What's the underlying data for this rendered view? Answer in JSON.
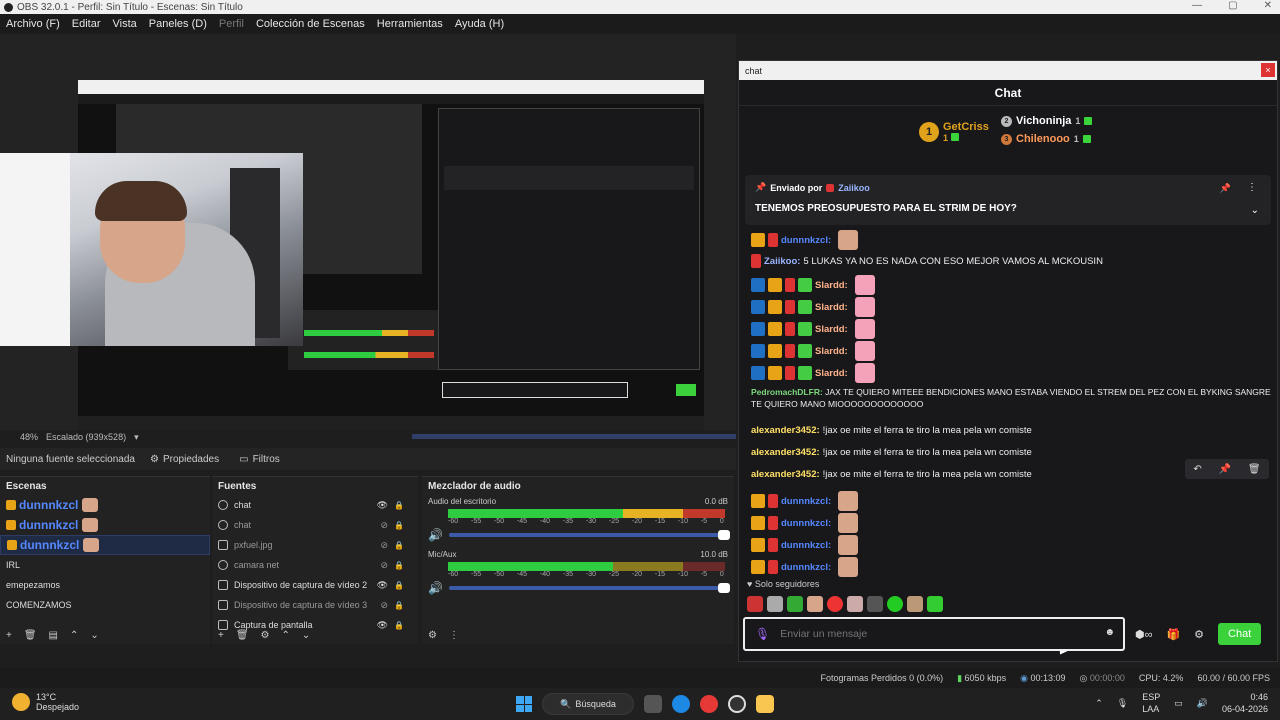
{
  "window": {
    "title": "OBS 32.0.1 - Perfil: Sin Título - Escenas: Sin Título",
    "controls": [
      "—",
      "▢",
      "✕"
    ]
  },
  "menu": [
    "Archivo (F)",
    "Editar",
    "Vista",
    "Paneles (D)",
    "Perfil",
    "Colección de Escenas",
    "Herramientas",
    "Ayuda (H)"
  ],
  "zoom": {
    "level": "48%",
    "scaling": "Escalado (939x528)"
  },
  "props": {
    "none_selected": "Ninguna fuente seleccionada",
    "properties": "Propiedades",
    "filters": "Filtros"
  },
  "scenes": {
    "title": "Escenas",
    "items": [
      "dunnnkzcl",
      "dunnnkzcl",
      "dunnnkzcl",
      "IRL",
      "emepezamos",
      "COMENZAMOS"
    ]
  },
  "sources": {
    "title": "Fuentes",
    "items": [
      {
        "label": "chat",
        "icon": "globe-icon"
      },
      {
        "label": "chat",
        "icon": "globe-icon"
      },
      {
        "label": "pxfuel.jpg",
        "icon": "image-icon"
      },
      {
        "label": "camara net",
        "icon": "globe-icon"
      },
      {
        "label": "Dispositivo de captura de vídeo 2",
        "icon": "camera-icon"
      },
      {
        "label": "Dispositivo de captura de vídeo 3",
        "icon": "camera-icon"
      },
      {
        "label": "Captura de pantalla",
        "icon": "monitor-icon"
      }
    ]
  },
  "mixer": {
    "title": "Mezclador de audio",
    "channels": [
      {
        "name": "Audio del escritorio",
        "db": "0.0 dB",
        "level": 0.86
      },
      {
        "name": "Mic/Aux",
        "db": "10.0 dB",
        "level": 0.86
      }
    ],
    "ticks": [
      "-60",
      "-55",
      "-50",
      "-45",
      "-40",
      "-35",
      "-30",
      "-25",
      "-20",
      "-15",
      "-10",
      "-5",
      "0"
    ]
  },
  "status": {
    "dropped": "Fotogramas Perdidos 0 (0.0%)",
    "bitrate": "6050 kbps",
    "live": "00:13:09",
    "rec": "00:00:00",
    "cpu": "CPU: 4.2%",
    "fps": "60.00 / 60.00 FPS"
  },
  "taskbar": {
    "temp": "13°C",
    "weather": "Despejado",
    "search": "Búsqueda",
    "lang1": "ESP",
    "lang2": "LAA",
    "time": "0:46",
    "date": "06-04-2026"
  },
  "chat": {
    "window_title": "chat",
    "header": "Chat",
    "leaders": [
      {
        "rank": "1",
        "name": "GetCriss",
        "count": "1"
      },
      {
        "rank": "2",
        "name": "Vichoninja",
        "count": "1"
      },
      {
        "rank": "3",
        "name": "Chilenooo",
        "count": "1"
      }
    ],
    "pinned": {
      "sent_by": "Enviado por",
      "user": "Zaiikoo",
      "text": "TENEMOS PREOSUPUESTO PARA EL STRIM DE HOY?"
    },
    "messages": [
      {
        "user": "dunnnkzcl:",
        "text": "",
        "style": "blue",
        "emote": true
      },
      {
        "user": "Zaiikoo:",
        "text": "5 LUKAS YA NO ES NADA CON ESO MEJOR VAMOS AL MCKOUSIN",
        "style": "lblue",
        "emote": false
      },
      {
        "user": "Slardd:",
        "text": "",
        "style": "peach",
        "emote": true
      },
      {
        "user": "Slardd:",
        "text": "",
        "style": "peach",
        "emote": true
      },
      {
        "user": "Slardd:",
        "text": "",
        "style": "peach",
        "emote": true
      },
      {
        "user": "Slardd:",
        "text": "",
        "style": "peach",
        "emote": true
      },
      {
        "user": "Slardd:",
        "text": "",
        "style": "peach",
        "emote": true
      },
      {
        "user": "PedromachDLFR:",
        "text": "JAX TE QUIERO MITEEE BENDICIONES MANO ESTABA VIENDO EL STREM DEL PEZ CON EL BYKING SANGRE",
        "text2": "TE QUIERO MANO MIOOOOOOOOOOOOO",
        "style": "green",
        "emote": false
      },
      {
        "user": "alexander3452:",
        "text": "!jax oe mite el ferra te tiro la mea pela wn comiste",
        "style": "yellow",
        "emote": false
      },
      {
        "user": "alexander3452:",
        "text": "!jax oe mite el ferra te tiro la mea pela wn comiste",
        "style": "yellow",
        "emote": false
      },
      {
        "user": "alexander3452:",
        "text": "!jax oe mite el ferra te tiro la mea pela wn comiste",
        "style": "yellow",
        "emote": false
      },
      {
        "user": "dunnnkzcl:",
        "text": "",
        "style": "blue",
        "emote": true
      },
      {
        "user": "dunnnkzcl:",
        "text": "",
        "style": "blue",
        "emote": true
      },
      {
        "user": "dunnnkzcl:",
        "text": "",
        "style": "blue",
        "emote": true
      },
      {
        "user": "dunnnkzcl:",
        "text": "",
        "style": "blue",
        "emote": true
      }
    ],
    "followers_only": "Solo seguidores",
    "input_placeholder": "Enviar un mensaje",
    "send_label": "Chat"
  },
  "colors": {
    "accent_green": "#3ad13a",
    "meter_green": "#2ecc40",
    "meter_yellow": "#e6b422",
    "meter_red": "#c0392b",
    "selection_blue": "#1f2a44"
  }
}
